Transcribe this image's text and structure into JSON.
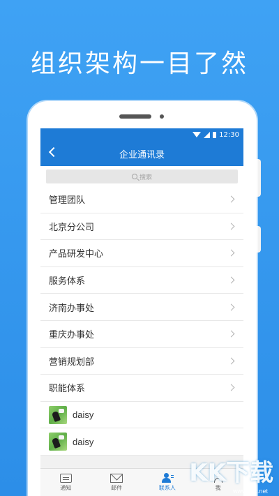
{
  "headline": "组织架构一目了然",
  "status_bar": {
    "time": "12:30"
  },
  "nav": {
    "title": "企业通讯录"
  },
  "search": {
    "placeholder": "搜索"
  },
  "departments": [
    {
      "label": "管理团队"
    },
    {
      "label": "北京分公司"
    },
    {
      "label": "产品研发中心"
    },
    {
      "label": "服务体系"
    },
    {
      "label": "济南办事处"
    },
    {
      "label": "重庆办事处"
    },
    {
      "label": "营销规划部"
    },
    {
      "label": "职能体系"
    }
  ],
  "contacts": [
    {
      "name": "daisy"
    },
    {
      "name": "daisy"
    }
  ],
  "tabs": [
    {
      "label": "通知",
      "icon": "message-icon"
    },
    {
      "label": "邮件",
      "icon": "mail-icon"
    },
    {
      "label": "联系人",
      "icon": "contacts-icon",
      "active": true
    },
    {
      "label": "我",
      "icon": "profile-icon"
    }
  ],
  "watermark": {
    "text": "KK下载",
    "url": "www.kkx.net"
  },
  "colors": {
    "accent": "#1e7bd6",
    "background": "#3fa2f4"
  }
}
